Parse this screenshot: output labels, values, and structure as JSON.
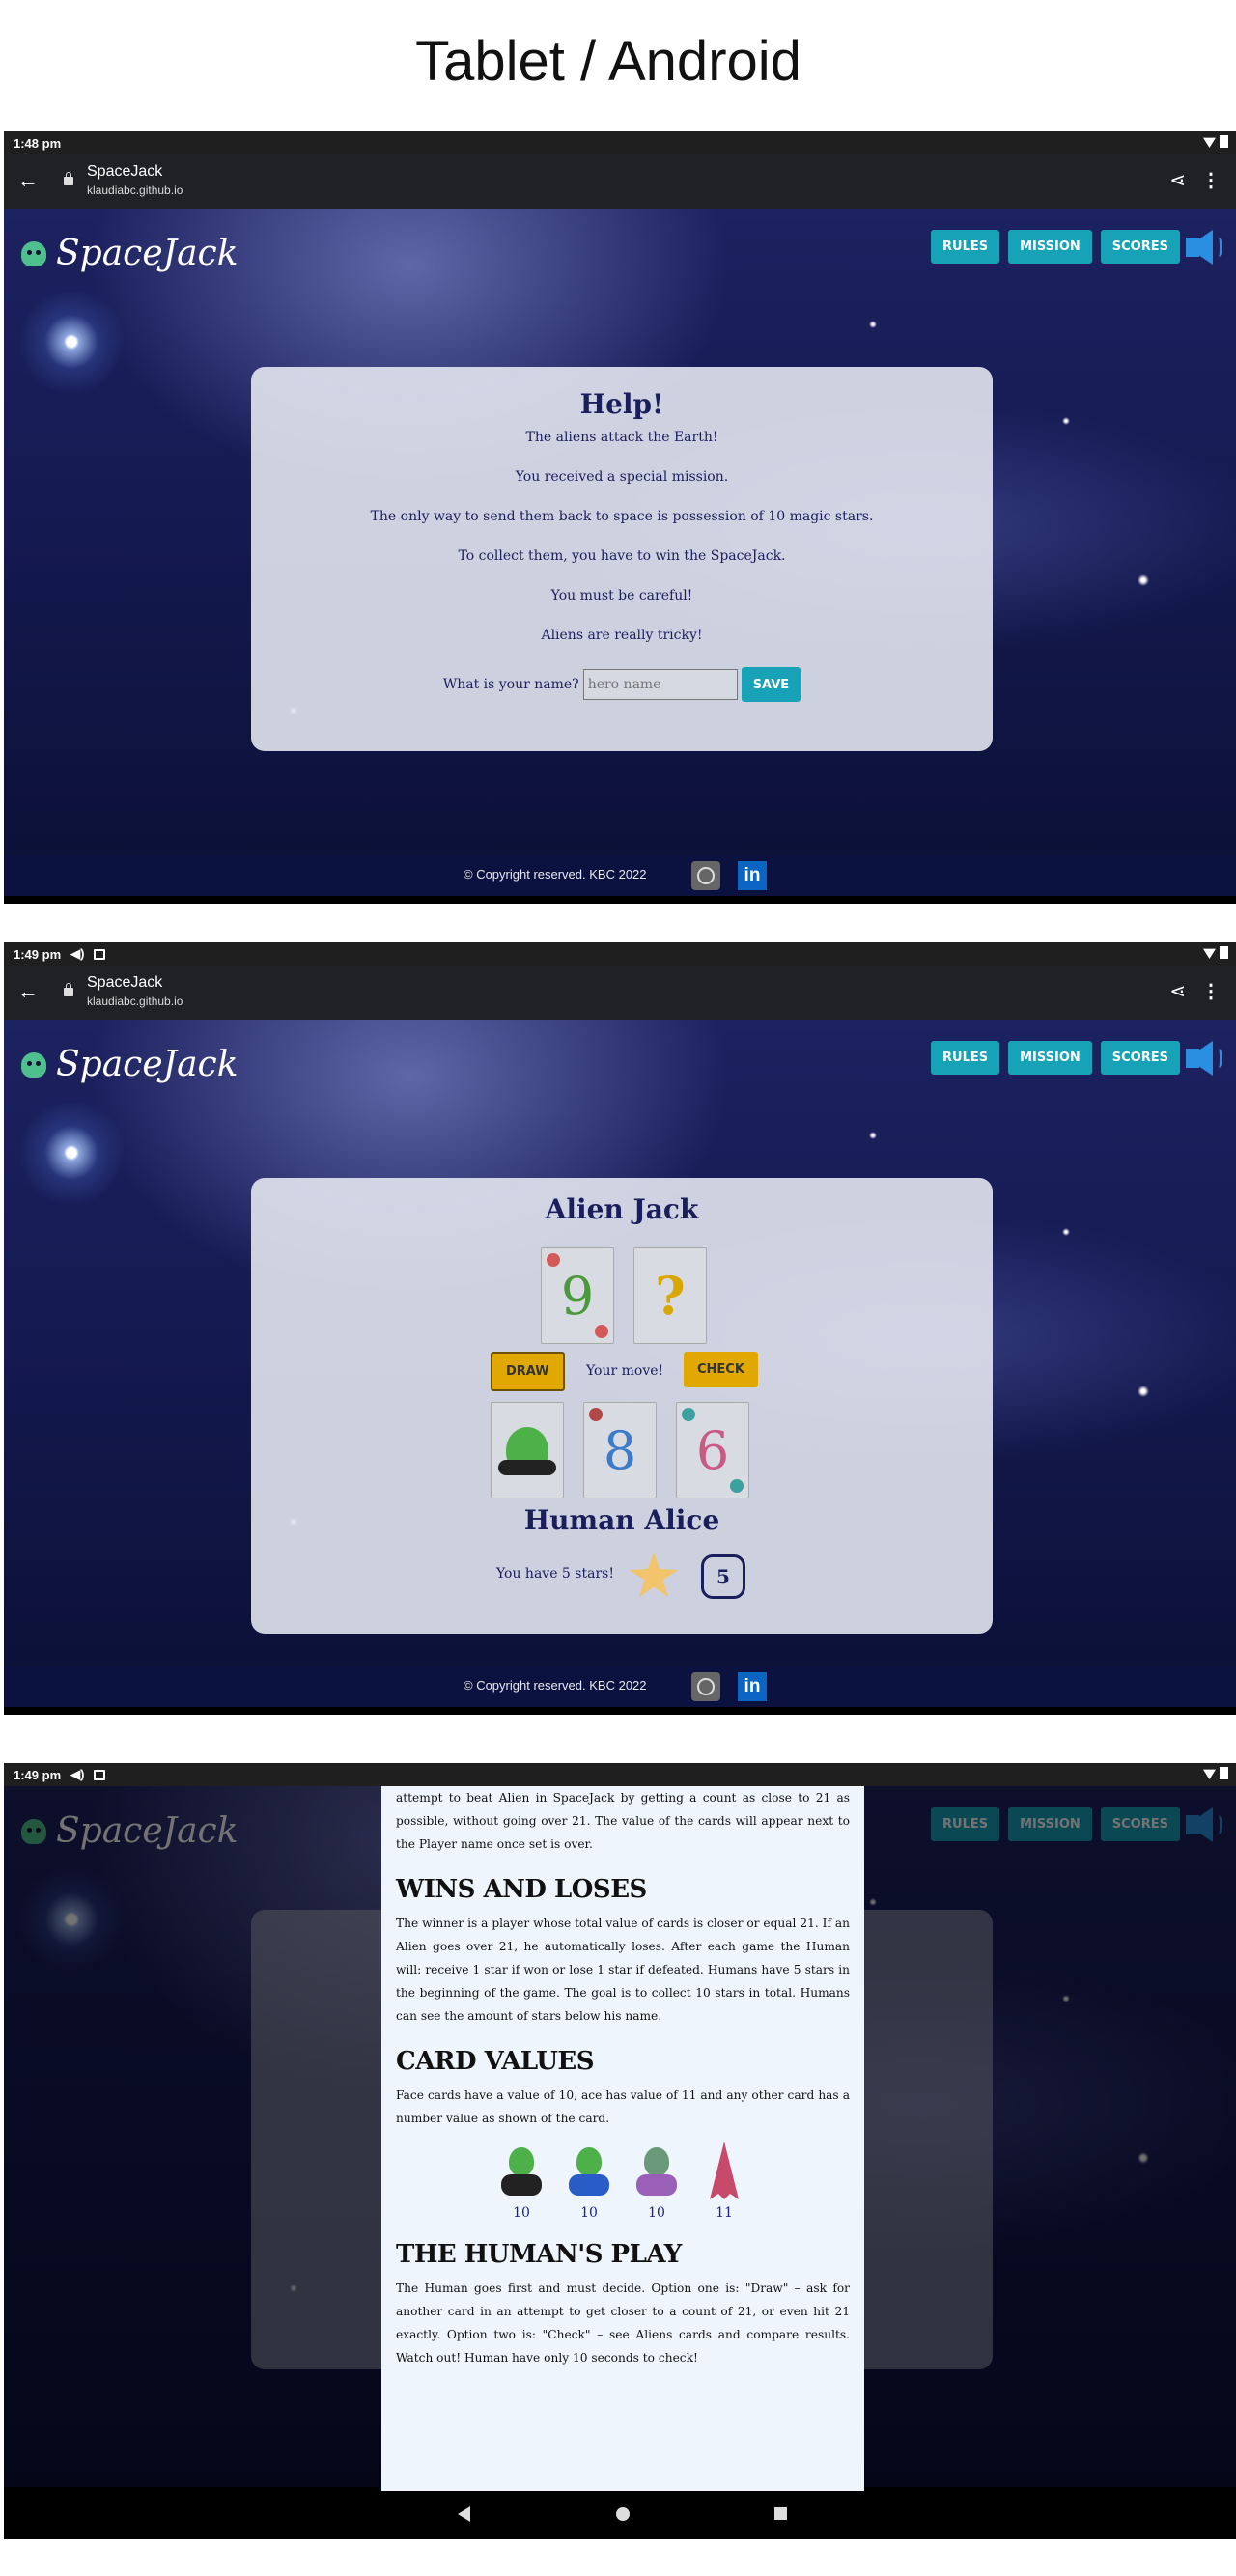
{
  "heading": "Tablet / Android",
  "browser": {
    "back_icon": "arrow-left-icon",
    "site_title": "SpaceJack",
    "host": "klaudiabc.github.io",
    "share_icon": "share-icon",
    "more_icon": "more-vert-icon"
  },
  "screens": [
    {
      "time": "1:48 pm"
    },
    {
      "time": "1:49 pm"
    },
    {
      "time": "1:49 pm"
    }
  ],
  "app": {
    "logo": "SpaceJack",
    "nav": {
      "rules": "RULES",
      "mission": "MISSION",
      "scores": "SCORES"
    },
    "sound_icon": "speaker-icon"
  },
  "help": {
    "title": "Help!",
    "lines": [
      "The aliens attack the Earth!",
      "You received a special mission.",
      "The only way to send them back to space is possession of 10 magic stars.",
      "To collect them, you have to win the SpaceJack.",
      "You must be careful!",
      "Aliens are really tricky!"
    ],
    "name_label": "What is your name?",
    "name_placeholder": "hero name",
    "save_label": "SAVE"
  },
  "game": {
    "alien_title": "Alien Jack",
    "alien_cards": [
      "9",
      "?"
    ],
    "draw_label": "DRAW",
    "move_text": "Your move!",
    "check_label": "CHECK",
    "human_cards": [
      "alien-king",
      "8",
      "6"
    ],
    "human_title": "Human Alice",
    "stars_text": "You have 5 stars!",
    "stars": 5
  },
  "footer": {
    "copyright": "© Copyright reserved. KBC 2022",
    "github_icon": "github-icon",
    "linkedin_label": "in"
  },
  "rules": {
    "intro": "attempt to beat Alien in SpaceJack by getting a count as close to 21 as possible, without going over 21. The value of the cards will appear next to the Player name once set is over.",
    "wins_title": "WINS AND LOSES",
    "wins_text": "The winner is a player whose total value of cards is closer or equal 21. If an Alien goes over 21, he automatically loses. After each game the Human will: receive 1 star if won or lose 1 star if defeated. Humans have 5 stars in the beginning of the game. The goal is to collect 10 stars in total. Humans can see the amount of stars below his name.",
    "values_title": "CARD VALUES",
    "values_text": "Face cards have a value of 10, ace has value of 11 and any other card has a number value as shown of the card.",
    "card_values": [
      "10",
      "10",
      "10",
      "11"
    ],
    "play_title": "THE HUMAN'S PLAY",
    "play_text": "The Human goes first and must decide. Option one is: \"Draw\" – ask for another card in an attempt to get closer to a count of 21, or even hit 21 exactly. Option two is: \"Check\" – see Aliens cards and compare results. Watch out! Human have only 10 seconds to check!"
  },
  "colors": {
    "accent": "#17a2b8",
    "action": "#e0a800",
    "panel_text": "#1a1f5c"
  }
}
